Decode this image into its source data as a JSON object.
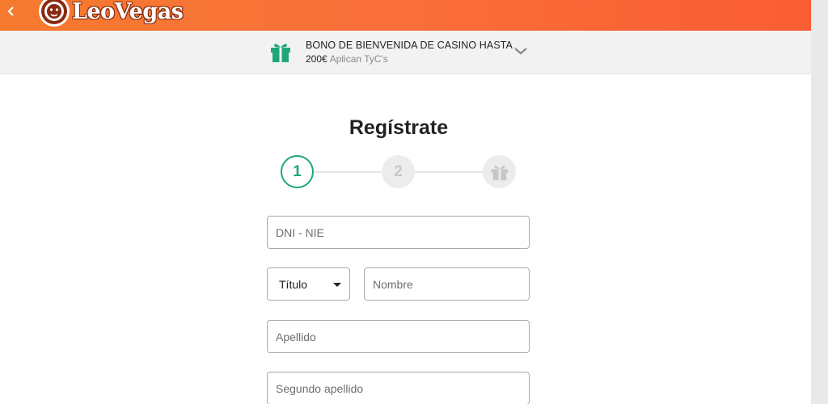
{
  "header": {
    "back_icon": "chevron-left-icon",
    "logo_text": "LeoVegas",
    "logo_icon": "lion-head-icon",
    "accent_color": "#f9703a"
  },
  "promo": {
    "icon": "gift-icon",
    "line1": "BONO DE BIENVENIDA DE CASINO HASTA",
    "amount": "200€",
    "terms": "Aplican TyC's",
    "chevron_icon": "chevron-down-icon",
    "icon_color": "#1fa67a"
  },
  "form": {
    "title": "Regístrate",
    "steps": [
      {
        "label": "1",
        "state": "active"
      },
      {
        "label": "2",
        "state": "inactive"
      },
      {
        "label": "",
        "icon": "gift-icon",
        "state": "inactive"
      }
    ],
    "fields": {
      "dni": {
        "placeholder": "DNI - NIE"
      },
      "title_select": {
        "value": "Título"
      },
      "nombre": {
        "placeholder": "Nombre"
      },
      "apellido": {
        "placeholder": "Apellido"
      },
      "segundo_apellido": {
        "placeholder": "Segundo apellido"
      }
    },
    "active_color": "#1fa67a"
  }
}
